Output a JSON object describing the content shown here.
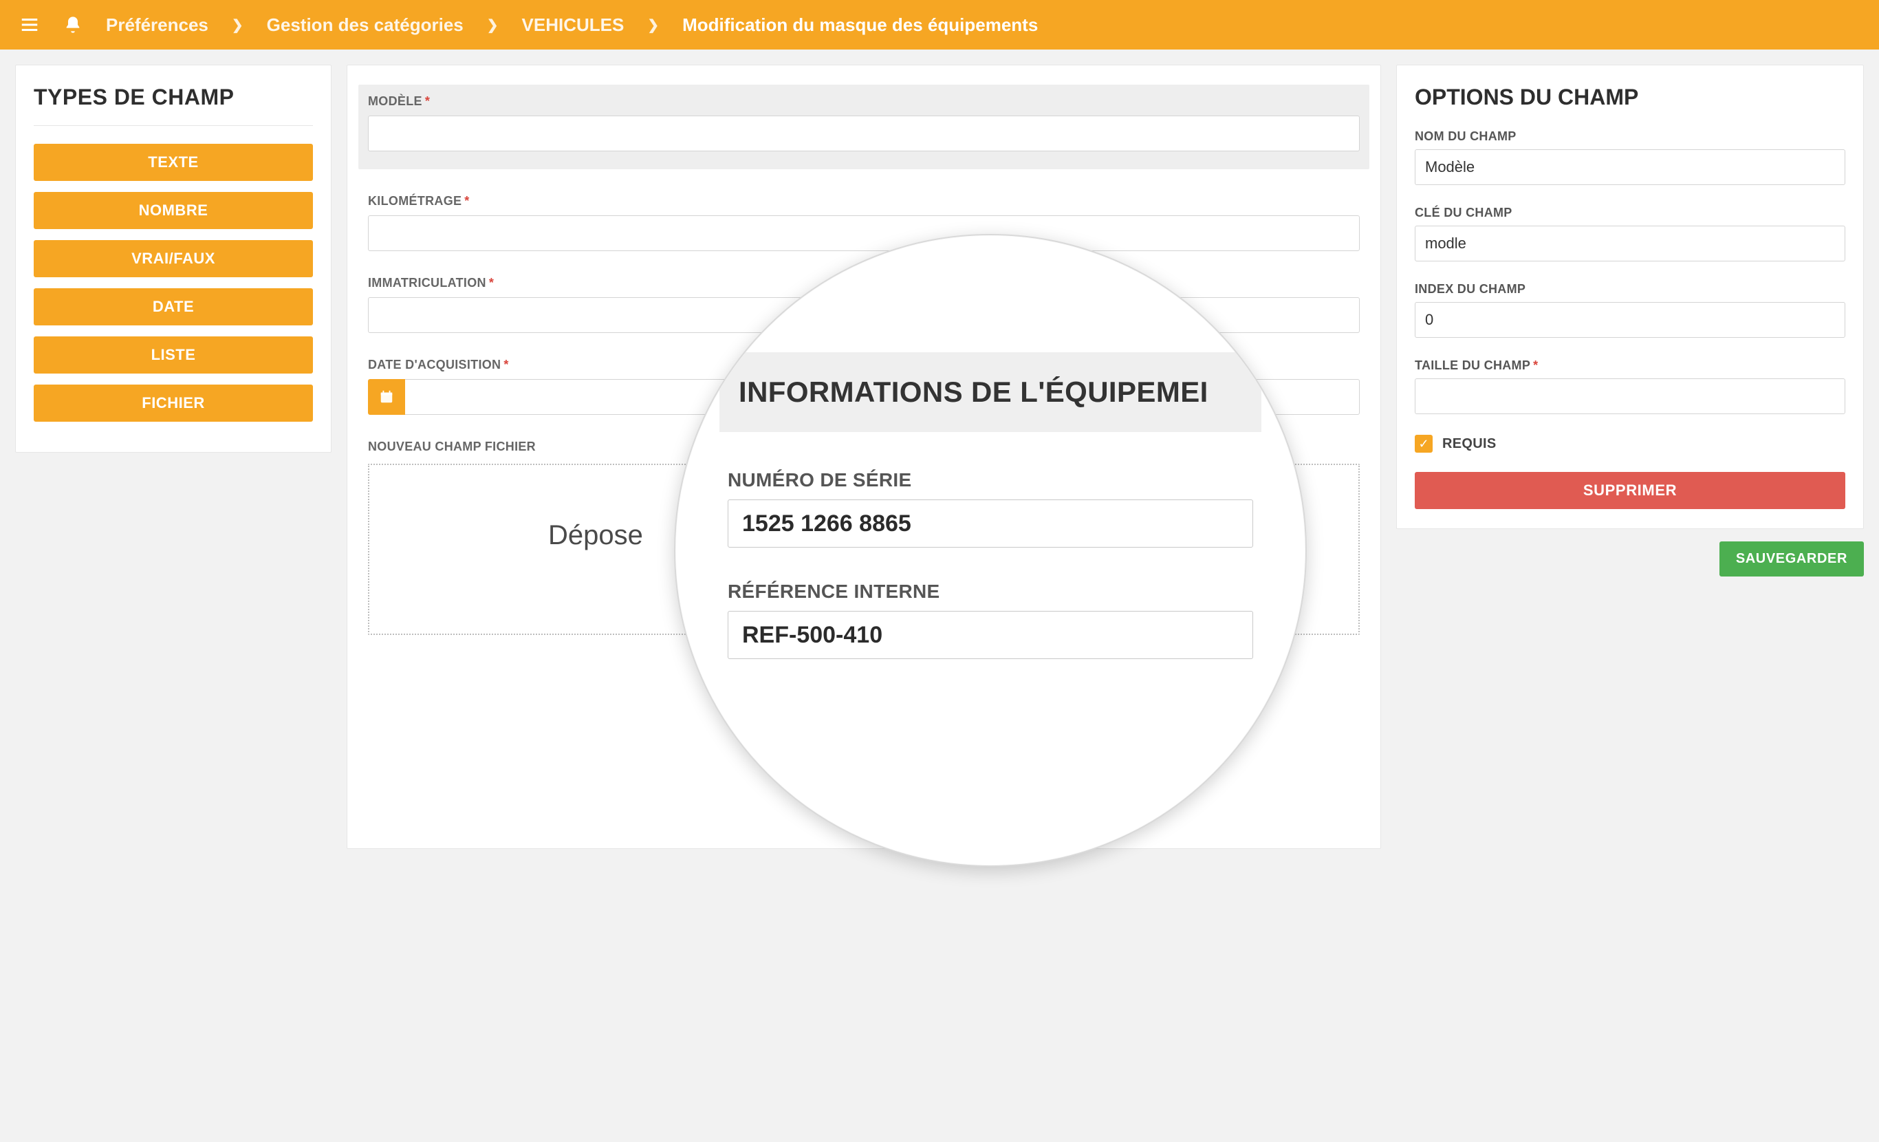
{
  "topbar": {
    "crumbs": [
      "Préférences",
      "Gestion des catégories",
      "VEHICULES",
      "Modification du masque des équipements"
    ]
  },
  "sidebar": {
    "title": "TYPES DE CHAMP",
    "types": [
      "TEXTE",
      "NOMBRE",
      "VRAI/FAUX",
      "DATE",
      "LISTE",
      "FICHIER"
    ]
  },
  "main": {
    "fields": [
      {
        "key": "modele",
        "label": "MODÈLE",
        "required": true,
        "selected": true
      },
      {
        "key": "kilometrage",
        "label": "KILOMÉTRAGE",
        "required": true
      },
      {
        "key": "immatriculation",
        "label": "IMMATRICULATION",
        "required": true
      },
      {
        "key": "date_acquisition",
        "label": "DATE D'ACQUISITION",
        "required": true,
        "type": "date"
      }
    ],
    "dropzone_title": "NOUVEAU CHAMP FICHIER",
    "dropzone_text": "Dépose"
  },
  "options": {
    "title": "OPTIONS DU CHAMP",
    "nom_label": "NOM DU CHAMP",
    "nom_value": "Modèle",
    "cle_label": "CLÉ DU CHAMP",
    "cle_value": "modle",
    "index_label": "INDEX DU CHAMP",
    "index_value": "0",
    "taille_label": "TAILLE DU CHAMP",
    "taille_value": "",
    "requis_label": "REQUIS",
    "requis_checked": true,
    "delete_label": "SUPPRIMER",
    "save_label": "SAUVEGARDER"
  },
  "magnifier": {
    "banner": "INFORMATIONS DE L'ÉQUIPEMEI",
    "serial_label": "NUMÉRO DE SÉRIE",
    "serial_value": "1525 1266 8865",
    "ref_label": "RÉFÉRENCE INTERNE",
    "ref_value": "REF-500-410"
  }
}
